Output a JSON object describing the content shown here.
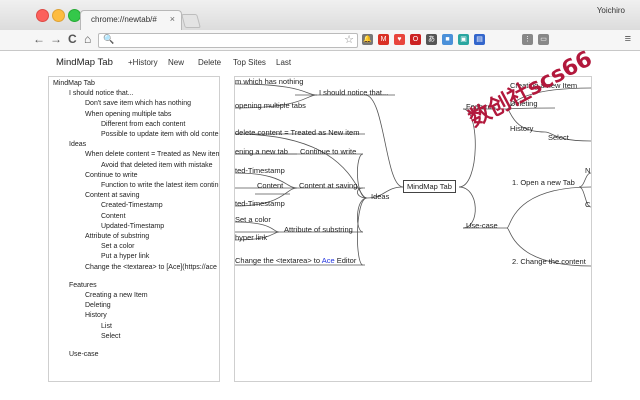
{
  "browser": {
    "tab_title": "chrome://newtab/#",
    "tab_close": "×",
    "profile": "Yoichiro",
    "nav": {
      "back": "←",
      "forward": "→",
      "reload": "C",
      "home": "⌂"
    },
    "omni_icon": "🔍",
    "star": "☆",
    "menu": "≡",
    "extensions": [
      {
        "name": "bell-extension",
        "glyph": "🔔",
        "color": "#777777"
      },
      {
        "name": "gmail-extension",
        "glyph": "M",
        "color": "#d93025"
      },
      {
        "name": "pocket-extension",
        "glyph": "♥",
        "color": "#e8453c"
      },
      {
        "name": "opera-extension",
        "glyph": "O",
        "color": "#cc2222"
      },
      {
        "name": "jp-extension",
        "glyph": "あ",
        "color": "#555555"
      },
      {
        "name": "blue-extension",
        "glyph": "■",
        "color": "#4a90d9"
      },
      {
        "name": "teal-extension",
        "glyph": "▣",
        "color": "#2aa6a0"
      },
      {
        "name": "doc-extension",
        "glyph": "▤",
        "color": "#3366cc"
      },
      {
        "name": "grid-extension",
        "glyph": "⋮",
        "color": "#888888"
      },
      {
        "name": "cast-extension",
        "glyph": "▭",
        "color": "#888888"
      }
    ]
  },
  "app": {
    "title": "MindMap Tab",
    "menu": [
      "+History",
      "New",
      "Delete",
      "Top Sites",
      "Last"
    ]
  },
  "outline": {
    "lines": [
      {
        "text": "MindMap Tab",
        "indent": 0
      },
      {
        "text": "I should notice that...",
        "indent": 1
      },
      {
        "text": "Don't save item which has nothing",
        "indent": 2
      },
      {
        "text": "When opening multiple tabs",
        "indent": 2
      },
      {
        "text": "Different from each content",
        "indent": 3
      },
      {
        "text": "Possible to update item with old content",
        "indent": 3
      },
      {
        "text": "Ideas",
        "indent": 1
      },
      {
        "text": "When delete content = Treated as New item",
        "indent": 2
      },
      {
        "text": "Avoid that deleted item with mistake",
        "indent": 3
      },
      {
        "text": "Continue to write",
        "indent": 2
      },
      {
        "text": "Function to write the latest item continue",
        "indent": 3
      },
      {
        "text": "Content at saving",
        "indent": 2
      },
      {
        "text": "Created-Timestamp",
        "indent": 3
      },
      {
        "text": "Content",
        "indent": 3
      },
      {
        "text": "Updated-Timestamp",
        "indent": 3
      },
      {
        "text": "Attribute of substring",
        "indent": 2
      },
      {
        "text": "Set a color",
        "indent": 3
      },
      {
        "text": "Put a hyper link",
        "indent": 3
      },
      {
        "text": "Change the <textarea> to [Ace](https://ace",
        "indent": 2
      },
      {
        "text": "",
        "indent": 0
      },
      {
        "text": "Features",
        "indent": 1
      },
      {
        "text": "Creating a new Item",
        "indent": 2
      },
      {
        "text": "Deleting",
        "indent": 2
      },
      {
        "text": "History",
        "indent": 2
      },
      {
        "text": "List",
        "indent": 3
      },
      {
        "text": "Select",
        "indent": 3
      },
      {
        "text": "",
        "indent": 0
      },
      {
        "text": "Use-case",
        "indent": 1
      }
    ]
  },
  "mindmap": {
    "root": "MindMap Tab",
    "notice": "I should notice that...",
    "notice_children": [
      "m which has nothing",
      "opening multiple tabs"
    ],
    "ideas": "Ideas",
    "idea_delete": "delete content = Treated as New item",
    "continue": "Continue to write",
    "continue_child": "ening a new tab",
    "saving": "Content at saving",
    "saving_children": [
      "ted-Timestamp",
      "Content",
      "ted-Timestamp"
    ],
    "substring": "Attribute of substring",
    "substring_children": [
      "Set a color",
      "hyper link"
    ],
    "change_prefix": "Change the <textarea> to ",
    "change_ace": "Ace",
    "change_suffix": " Editor",
    "features": "Features",
    "features_children": [
      "Creating a new Item",
      "Deleting",
      "History"
    ],
    "history_children": [
      "Select"
    ],
    "usecase": "Use-case",
    "usecase_children": [
      "1. Open a new Tab",
      "2. Change the content"
    ],
    "overflow_marks": [
      "N",
      "C"
    ]
  },
  "watermark": "数创社scs66"
}
